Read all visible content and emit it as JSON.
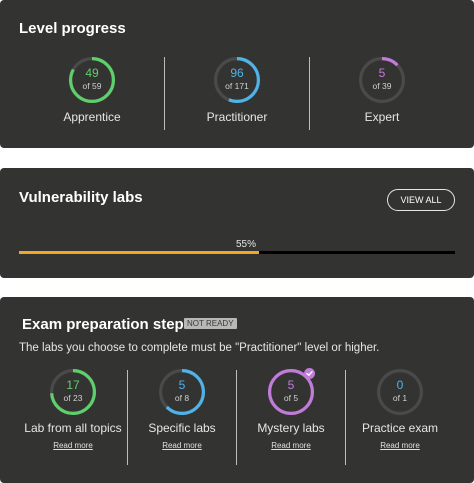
{
  "level_progress": {
    "title": "Level progress",
    "items": [
      {
        "value": "49",
        "of": "of 59",
        "label": "Apprentice",
        "fraction": 0.8305,
        "color": "#5fcf6b"
      },
      {
        "value": "96",
        "of": "of 171",
        "label": "Practitioner",
        "fraction": 0.5614,
        "color": "#4fb3e8"
      },
      {
        "value": "5",
        "of": "of 39",
        "label": "Expert",
        "fraction": 0.1282,
        "color": "#c07cd8"
      }
    ]
  },
  "vulnerability_labs": {
    "title": "Vulnerability labs",
    "view_all_label": "VIEW ALL",
    "progress_label": "55%",
    "progress_fraction": 0.55,
    "progress_color": "#f2a627"
  },
  "exam_preparation": {
    "title": "Exam preparation steps",
    "badge": "NOT READY",
    "description": "The labs you choose to complete must be \"Practitioner\" level or higher.",
    "steps": [
      {
        "value": "17",
        "of": "of 23",
        "label": "Lab from all topics",
        "link": "Read more",
        "fraction": 0.7391,
        "color": "#5fcf6b"
      },
      {
        "value": "5",
        "of": "of 8",
        "label": "Specific labs",
        "link": "Read more",
        "fraction": 0.625,
        "color": "#4fb3e8"
      },
      {
        "value": "5",
        "of": "of 5",
        "label": "Mystery labs",
        "link": "Read more",
        "fraction": 1.0,
        "color": "#c07cd8",
        "completed": true
      },
      {
        "value": "0",
        "of": "of 1",
        "label": "Practice exam",
        "link": "Read more",
        "fraction": 0.0,
        "color": "#4fb3e8"
      }
    ]
  },
  "colors": {
    "card_bg": "#333332",
    "ring_track": "#4a4a4a"
  }
}
